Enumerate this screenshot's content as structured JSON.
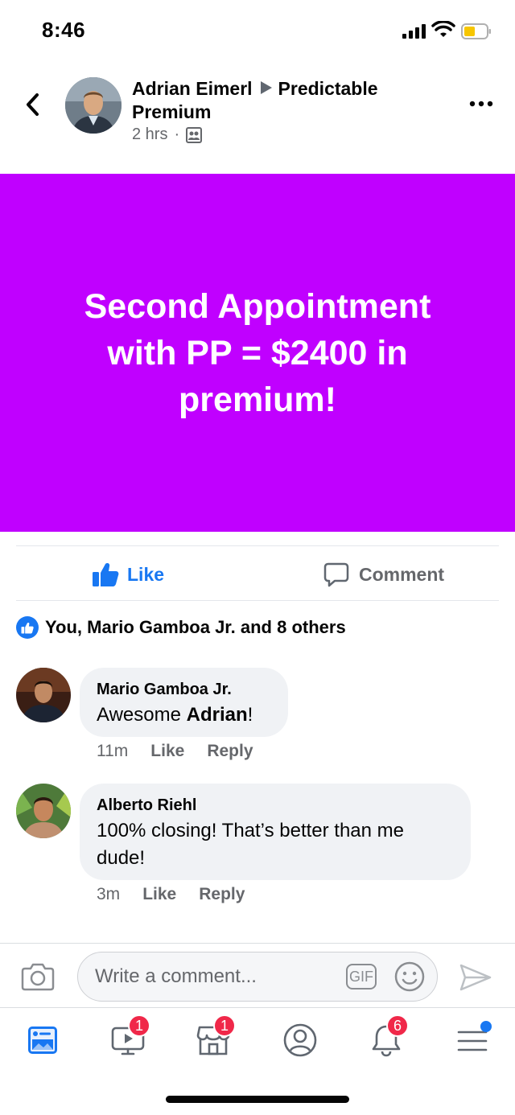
{
  "status_bar": {
    "time": "8:46"
  },
  "post": {
    "author": "Adrian Eimerl",
    "group": "Predictable Premium",
    "time": "2 hrs",
    "separator": "·",
    "banner_text": "Second Appointment with PP = $2400 in premium!",
    "banner_color": "#c000ff"
  },
  "actions": {
    "like_label": "Like",
    "comment_label": "Comment"
  },
  "reactions": {
    "summary": "You, Mario Gamboa Jr. and 8 others"
  },
  "comments": [
    {
      "name": "Mario Gamboa Jr.",
      "text_prefix": "Awesome ",
      "mention": "Adrian",
      "text_suffix": "!",
      "time": "11m",
      "like_label": "Like",
      "reply_label": "Reply"
    },
    {
      "name": "Alberto Riehl",
      "text_line1": "100% closing! That’s better than me",
      "text_line2": "dude!",
      "time": "3m",
      "like_label": "Like",
      "reply_label": "Reply"
    }
  ],
  "composer": {
    "placeholder": "Write a comment...",
    "gif_label": "GIF"
  },
  "bottom_nav": {
    "items": [
      {
        "icon": "news-feed-icon"
      },
      {
        "icon": "watch-icon",
        "badge": "1"
      },
      {
        "icon": "marketplace-icon",
        "badge": "1"
      },
      {
        "icon": "profile-icon"
      },
      {
        "icon": "notifications-icon",
        "badge": "6"
      },
      {
        "icon": "menu-icon"
      }
    ]
  },
  "colors": {
    "accent": "#1877f2",
    "badge": "#f02849",
    "banner": "#c000ff"
  }
}
